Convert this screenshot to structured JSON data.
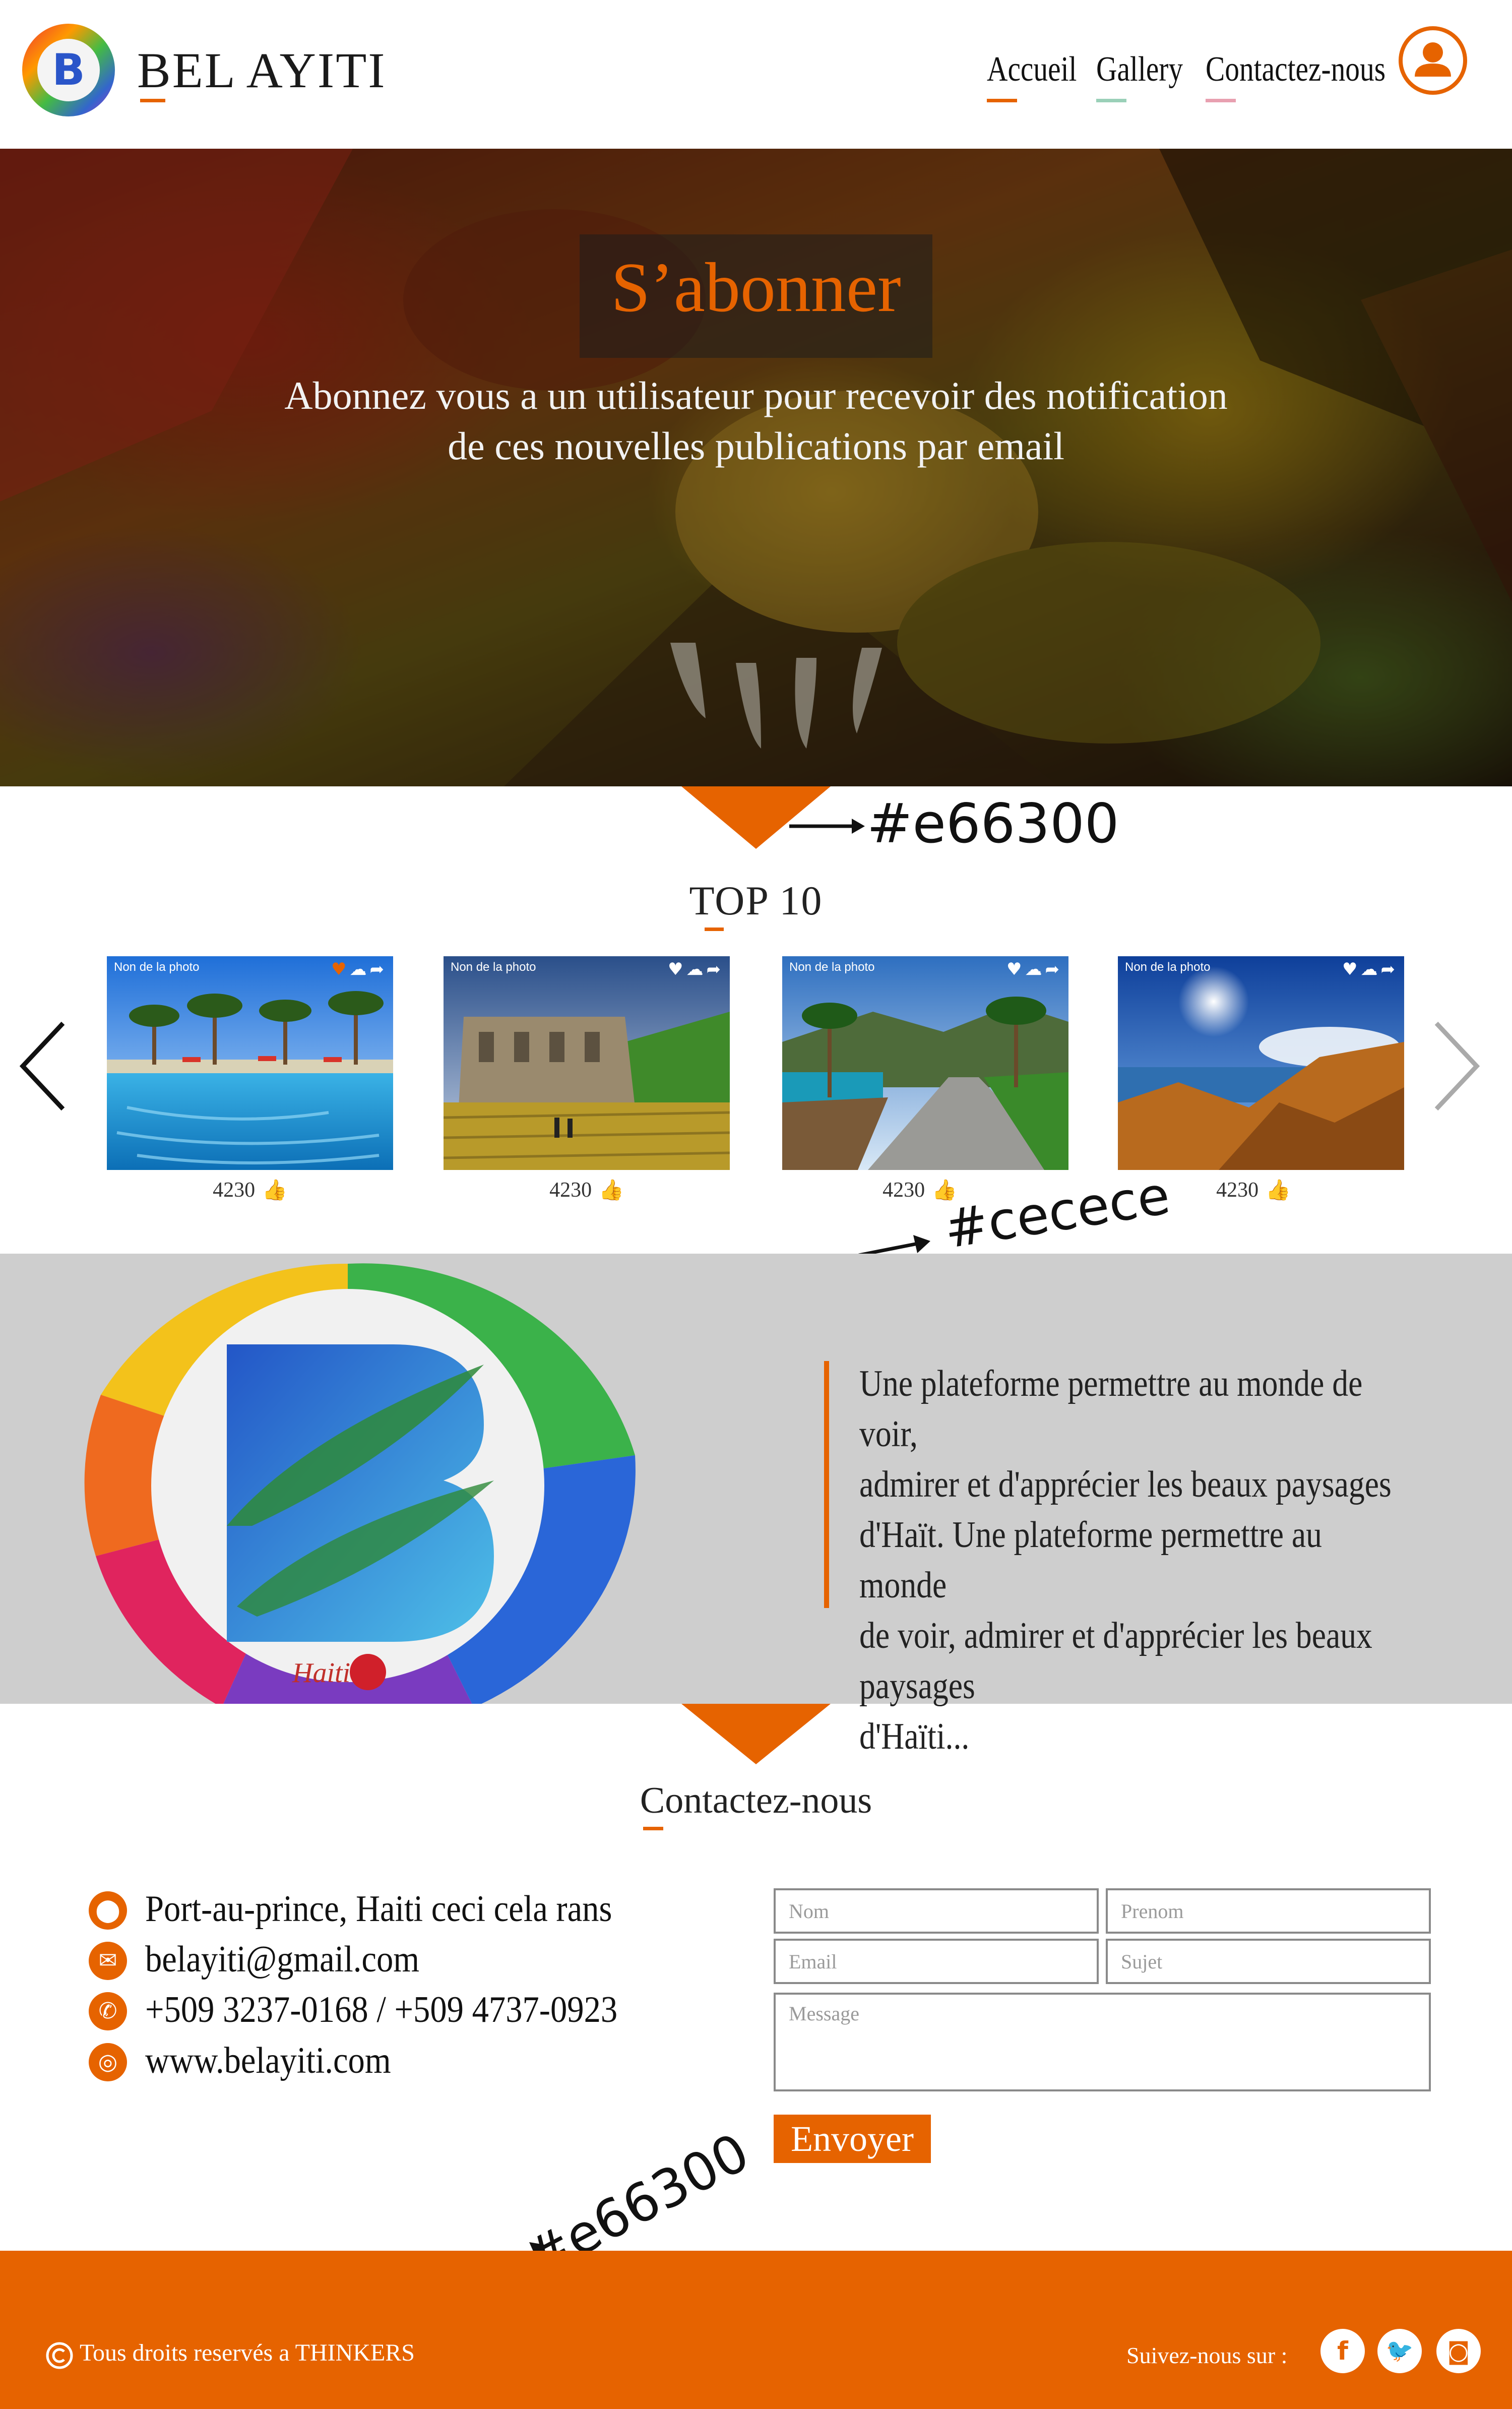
{
  "header": {
    "brand": "BEL AYITI",
    "nav": [
      {
        "label": "Accueil",
        "underline": "#e66300"
      },
      {
        "label": "Gallery",
        "underline": "#9ad0b8"
      },
      {
        "label": "Contactez-nous",
        "underline": "#e8a0b0"
      }
    ]
  },
  "hero": {
    "title": "S’abonner",
    "description": "Abonnez vous a un utilisateur pour recevoir des notification\nde ces nouvelles publications par email"
  },
  "annotations": {
    "accent_color_note": "#e66300",
    "gray_color_note": "#cecece",
    "footer_color_note": "#e66300"
  },
  "top10": {
    "title": "TOP 10",
    "prev_icon": "chevron-left-icon",
    "next_icon": "chevron-right-icon",
    "cards": [
      {
        "label": "Non de la photo",
        "likes": "4230",
        "favorited": true
      },
      {
        "label": "Non de la photo",
        "likes": "4230",
        "favorited": false
      },
      {
        "label": "Non de la photo",
        "likes": "4230",
        "favorited": false
      },
      {
        "label": "Non de la photo",
        "likes": "4230",
        "favorited": false
      }
    ]
  },
  "about": {
    "text": "Une plateforme permettre au monde de voir,\nadmirer et d'apprécier les beaux paysages\nd'Haït. Une plateforme permettre au monde\nde voir, admirer et d'apprécier les beaux paysages\nd'Haïti...",
    "logo_caption": "Haiti"
  },
  "contact": {
    "title": "Contactez-nous",
    "address": "Port-au-prince, Haiti ceci cela rans",
    "email": "belayiti@gmail.com",
    "phone": "+509 3237-0168 / +509 4737-0923",
    "website": "www.belayiti.com",
    "form": {
      "nom_placeholder": "Nom",
      "prenom_placeholder": "Prenom",
      "email_placeholder": "Email",
      "sujet_placeholder": "Sujet",
      "message_placeholder": "Message",
      "send_label": "Envoyer"
    }
  },
  "footer": {
    "copyright": "Tous droits reservés a THINKERS",
    "follow_label": "Suivez-nous sur :",
    "socials": [
      "facebook-icon",
      "twitter-icon",
      "instagram-icon"
    ]
  },
  "colors": {
    "accent": "#e66300",
    "section_gray": "#cecece",
    "text": "#222222"
  }
}
